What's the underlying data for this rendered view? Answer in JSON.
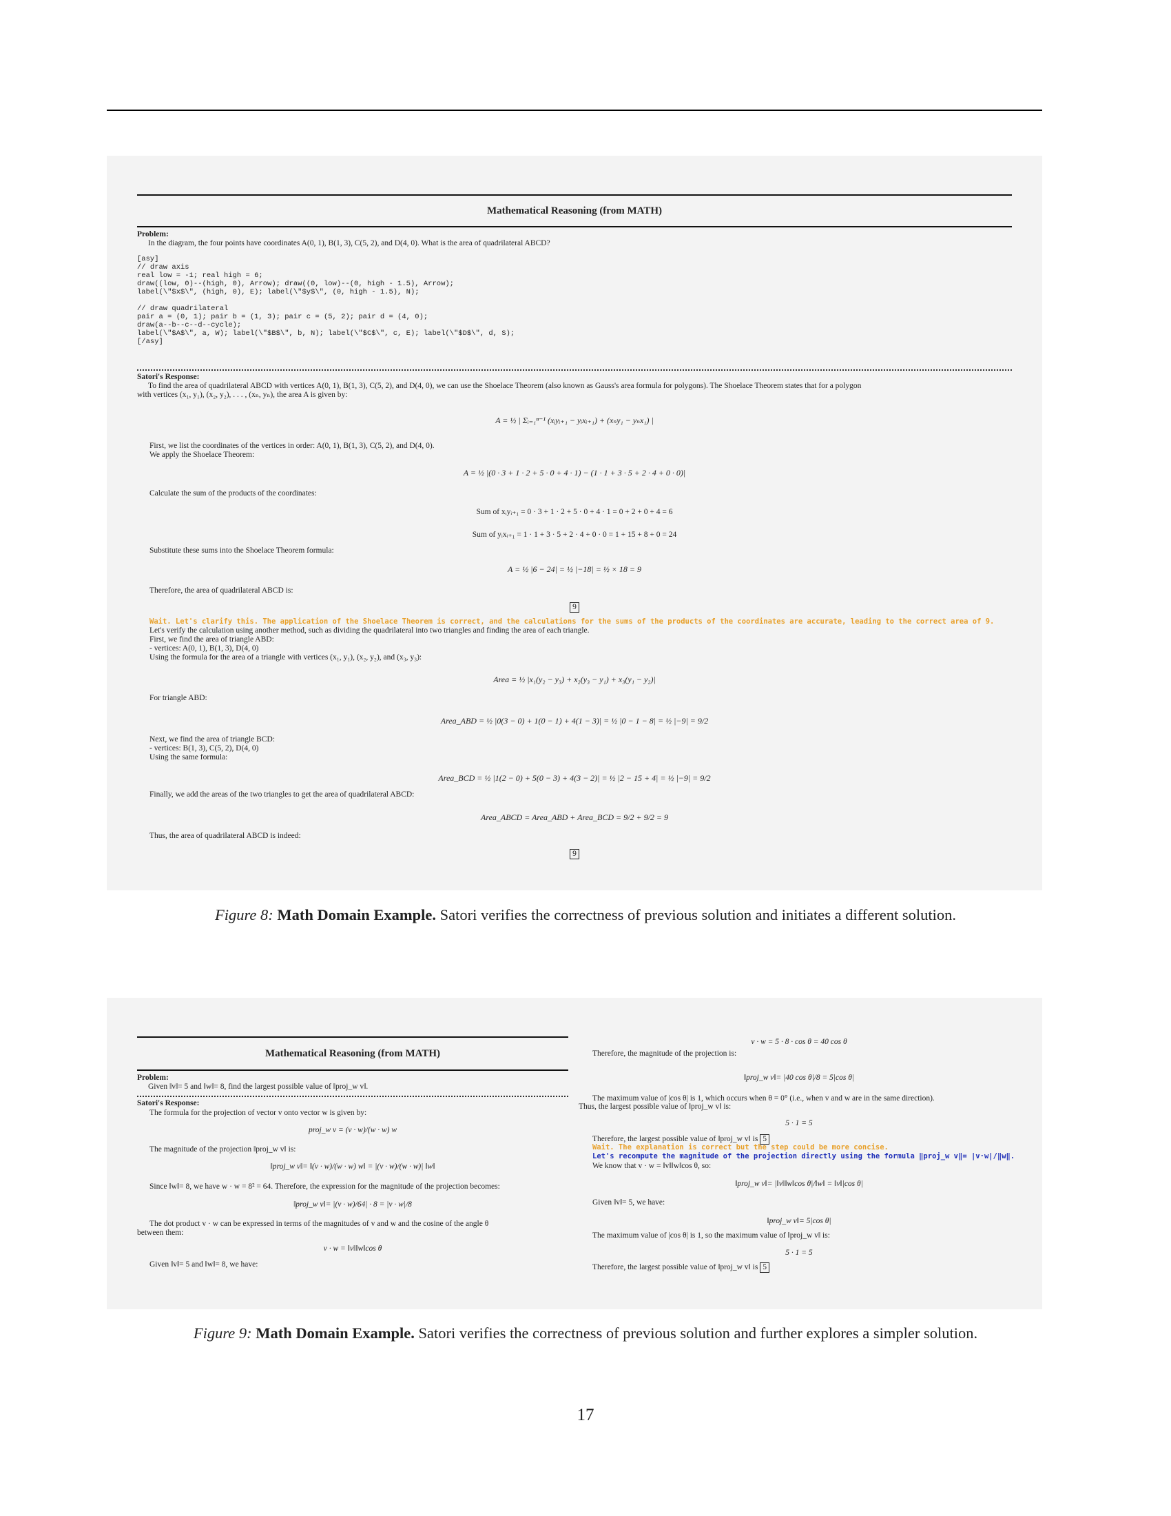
{
  "figure8": {
    "box_title": "Mathematical Reasoning (from MATH)",
    "problem_label": "Problem:",
    "problem_text": "In the diagram, the four points have coordinates A(0, 1), B(1, 3), C(5, 2), and D(4, 0). What is the area of quadrilateral ABCD?",
    "code_lines": [
      "[asy]",
      "// draw axis",
      "real low = -1; real high = 6;",
      "draw((low, 0)--(high, 0), Arrow); draw((0, low)--(0, high - 1.5), Arrow);",
      "label(\\\"$x$\\\", (high, 0), E); label(\\\"$y$\\\", (0, high - 1.5), N);",
      "",
      "// draw quadrilateral",
      "pair a = (0, 1); pair b = (1, 3); pair c = (5, 2); pair d = (4, 0);",
      "draw(a--b--c--d--cycle);",
      "label(\\\"$A$\\\", a, W); label(\\\"$B$\\\", b, N); label(\\\"$C$\\\", c, E); label(\\\"$D$\\\", d, S);",
      "[/asy]"
    ],
    "response_label": "Satori's Response:",
    "resp_line1": "To find the area of quadrilateral ABCD with vertices A(0, 1), B(1, 3), C(5, 2), and D(4, 0), we can use the Shoelace Theorem (also known as Gauss's area formula for polygons). The Shoelace Theorem states that for a polygon",
    "resp_line2": "with vertices (x₁, y₁), (x₂, y₂), . . . , (xₙ, yₙ), the area A is given by:",
    "eq_shoelace": "A = ½ | Σᵢ₌₁ⁿ⁻¹ (xᵢyᵢ₊₁ − yᵢxᵢ₊₁) + (xₙy₁ − yₙx₁) |",
    "text_list": "First, we list the coordinates of the vertices in order: A(0, 1), B(1, 3), C(5, 2), and D(4, 0).",
    "text_apply": "We apply the Shoelace Theorem:",
    "eq_apply": "A = ½ |(0 · 3 + 1 · 2 + 5 · 0 + 4 · 1) − (1 · 1 + 3 · 5 + 2 · 4 + 0 · 0)|",
    "text_calc": "Calculate the sum of the products of the coordinates:",
    "eq_sum1": "Sum of xᵢyᵢ₊₁ = 0 · 3 + 1 · 2 + 5 · 0 + 4 · 1 = 0 + 2 + 0 + 4 = 6",
    "eq_sum2": "Sum of yᵢxᵢ₊₁ = 1 · 1 + 3 · 5 + 2 · 4 + 0 · 0 = 1 + 15 + 8 + 0 = 24",
    "text_subst": "Substitute these sums into the Shoelace Theorem formula:",
    "eq_subst": "A = ½ |6 − 24| = ½ |−18| = ½ × 18 = 9",
    "text_therefore": "Therefore, the area of quadrilateral ABCD is:",
    "answer1": "9",
    "wait_text": "Wait. Let's clarify this. The application of the Shoelace Theorem is correct, and the calculations for the sums of the products of the coordinates are accurate, leading to the correct area of 9.",
    "verify_lines": [
      "Let's verify the calculation using another method, such as dividing the quadrilateral into two triangles and finding the area of each triangle.",
      "First, we find the area of triangle ABD:",
      "- vertices: A(0, 1), B(1, 3), D(4, 0)",
      "Using the formula for the area of a triangle with vertices (x₁, y₁), (x₂, y₂), and (x₃, y₃):"
    ],
    "eq_area": "Area = ½ |x₁(y₂ − y₃) + x₂(y₃ − y₁) + x₃(y₁ − y₂)|",
    "text_abd": "For triangle ABD:",
    "eq_abd": "Area_ABD = ½ |0(3 − 0) + 1(0 − 1) + 4(1 − 3)| = ½ |0 − 1 − 8| = ½ |−9| = 9/2",
    "bcd_lines": [
      "Next, we find the area of triangle BCD:",
      "- vertices: B(1, 3), C(5, 2), D(4, 0)",
      "Using the same formula:"
    ],
    "eq_bcd": "Area_BCD = ½ |1(2 − 0) + 5(0 − 3) + 4(3 − 2)| = ½ |2 − 15 + 4| = ½ |−9| = 9/2",
    "text_finally": "Finally, we add the areas of the two triangles to get the area of quadrilateral ABCD:",
    "eq_total": "Area_ABCD = Area_ABD + Area_BCD = 9/2 + 9/2 = 9",
    "text_thus": "Thus, the area of quadrilateral ABCD is indeed:",
    "answer2": "9",
    "caption_label": "Figure 8:",
    "caption_bold": "Math Domain Example.",
    "caption_text": "Satori verifies the correctness of previous solution and initiates a different solution."
  },
  "figure9": {
    "box_title": "Mathematical Reasoning (from MATH)",
    "problem_label": "Problem:",
    "problem_text": "Given ‖v‖= 5 and ‖w‖= 8, find the largest possible value of ‖proj_w v‖.",
    "response_label": "Satori's Response:",
    "left": {
      "t1": "The formula for the projection of vector v onto vector w is given by:",
      "e1": "proj_w v = (v · w)/(w · w) w",
      "t2": "The magnitude of the projection ‖proj_w v‖ is:",
      "e2": "‖proj_w v‖= ‖(v · w)/(w · w) w‖ = |(v · w)/(w · w)| ‖w‖",
      "t3": "Since ‖w‖= 8, we have w · w = 8² = 64. Therefore, the expression for the magnitude of the projection becomes:",
      "e3": "‖proj_w v‖= |(v · w)/64| · 8 = |v · w|/8",
      "t4a": "The dot product v · w can be expressed in terms of the magnitudes of v and w and the cosine of the angle θ",
      "t4b": "between them:",
      "e4": "v · w = ‖v‖‖w‖cos θ",
      "t5": "Given ‖v‖= 5 and ‖w‖= 8, we have:"
    },
    "right": {
      "e1": "v · w = 5 · 8 · cos θ = 40 cos θ",
      "t1": "Therefore, the magnitude of the projection is:",
      "e2": "‖proj_w v‖= |40 cos θ|/8 = 5|cos θ|",
      "t2": "The maximum value of |cos θ| is 1, which occurs when θ = 0° (i.e., when v and w are in the same direction).",
      "t3": "Thus, the largest possible value of ‖proj_w v‖ is:",
      "e3": "5 · 1 = 5",
      "t4": "Therefore, the largest possible value of ‖proj_w v‖ is",
      "ans1": "5",
      "wait": "Wait. The explanation is correct but the step could be more concise.",
      "recompute": "Let's recompute the magnitude of the projection directly using the formula ‖proj_w v‖= |v·w|/‖w‖.",
      "t5": "We know that v · w = ‖v‖‖w‖cos θ, so:",
      "e4": "‖proj_w v‖= |‖v‖‖w‖cos θ|/‖w‖ = ‖v‖|cos θ|",
      "t6": "Given ‖v‖= 5, we have:",
      "e5": "‖proj_w v‖= 5|cos θ|",
      "t7": "The maximum value of |cos θ| is 1, so the maximum value of ‖proj_w v‖ is:",
      "e6": "5 · 1 = 5",
      "t8": "Therefore, the largest possible value of ‖proj_w v‖ is",
      "ans2": "5"
    },
    "caption_label": "Figure 9:",
    "caption_bold": "Math Domain Example.",
    "caption_text": "Satori verifies the correctness of previous solution and further explores a simpler solution."
  },
  "page_number": "17"
}
